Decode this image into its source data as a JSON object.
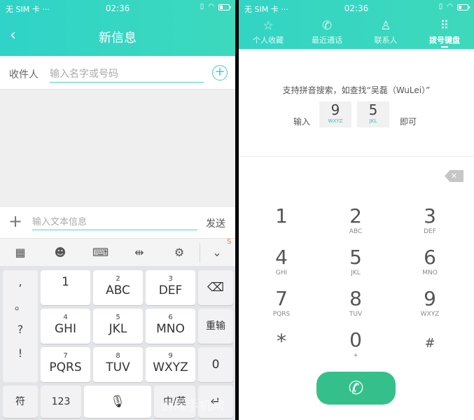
{
  "left": {
    "status": {
      "carrier": "无 SIM 卡 ···",
      "time": "02:36"
    },
    "title": "新信息",
    "recipient": {
      "label": "收件人",
      "placeholder": "输入名字或号码"
    },
    "compose": {
      "placeholder": "输入文本信息",
      "send": "发送"
    },
    "keyboard": {
      "punctuation": [
        ",",
        "。",
        "?",
        "!"
      ],
      "keys": [
        {
          "sup": "",
          "main": "1"
        },
        {
          "sup": "2",
          "main": "ABC"
        },
        {
          "sup": "3",
          "main": "DEF"
        },
        {
          "sup": "4",
          "main": "GHI"
        },
        {
          "sup": "5",
          "main": "JKL"
        },
        {
          "sup": "6",
          "main": "MNO"
        },
        {
          "sup": "7",
          "main": "PQRS"
        },
        {
          "sup": "8",
          "main": "TUV"
        },
        {
          "sup": "9",
          "main": "WXYZ"
        }
      ],
      "backspace_glyph": "⌫",
      "reinput": "重输",
      "zero": "0",
      "symbol": "符",
      "num123": "123",
      "lang": "中/英",
      "enter_glyph": "↵"
    }
  },
  "right": {
    "status": {
      "carrier": "无 SIM 卡 ···",
      "time": "02:36"
    },
    "tabs": [
      {
        "label": "个人收藏",
        "icon": "☆"
      },
      {
        "label": "最近通话",
        "icon": "✆"
      },
      {
        "label": "联系人",
        "icon": "♙"
      },
      {
        "label": "拨号键盘",
        "icon": "⠿"
      }
    ],
    "hint": {
      "text": "支持拼音搜索，如查找“吴磊（WuLei）”",
      "input_label": "输入",
      "key1": {
        "num": "9",
        "sub": "WXYZ"
      },
      "key2": {
        "num": "5",
        "sub": "JKL"
      },
      "then_label": "即可"
    },
    "dialpad": [
      {
        "num": "1",
        "sub": ""
      },
      {
        "num": "2",
        "sub": "ABC"
      },
      {
        "num": "3",
        "sub": "DEF"
      },
      {
        "num": "4",
        "sub": "GHI"
      },
      {
        "num": "5",
        "sub": "JKL"
      },
      {
        "num": "6",
        "sub": "MNO"
      },
      {
        "num": "7",
        "sub": "PQRS"
      },
      {
        "num": "8",
        "sub": "TUV"
      },
      {
        "num": "9",
        "sub": "WXYZ"
      },
      {
        "num": "*",
        "sub": ""
      },
      {
        "num": "0",
        "sub": "+"
      },
      {
        "num": "#",
        "sub": ""
      }
    ],
    "call_icon": "✆"
  },
  "watermark": "游戏手机网",
  "colors": {
    "accent": "#3dd6c0",
    "call_green": "#35c08b"
  }
}
